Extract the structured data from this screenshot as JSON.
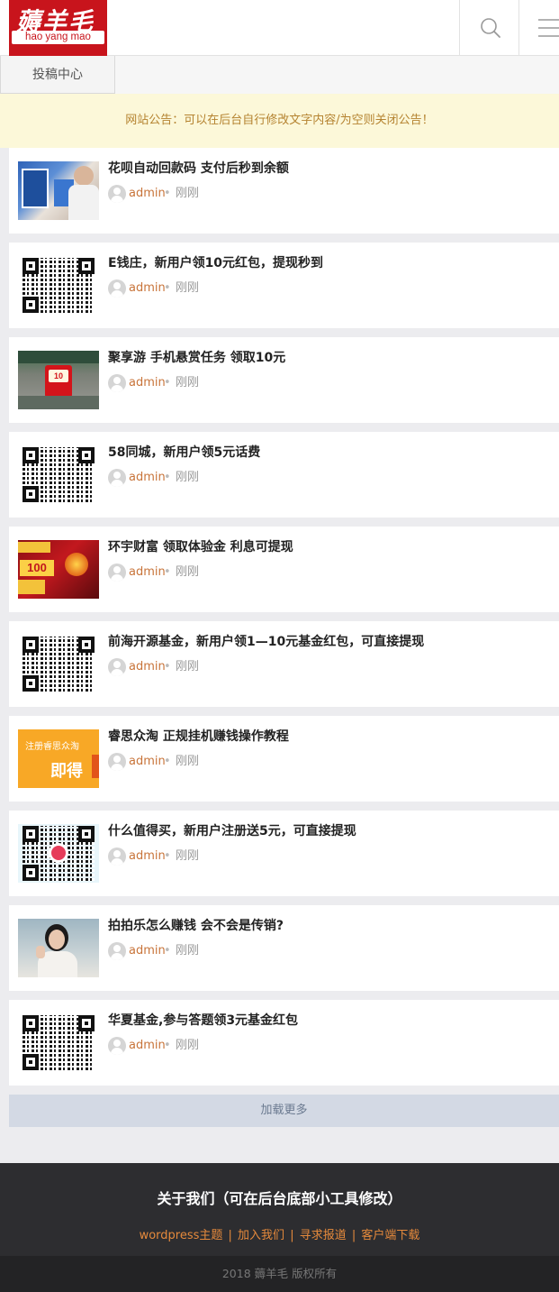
{
  "header": {
    "logo_cn": "薅羊毛",
    "logo_en": "hao yang mao"
  },
  "nav": {
    "tougao": "投稿中心"
  },
  "notice": "网站公告：可以在后台自行修改文字内容/为空则关闭公告！",
  "posts": [
    {
      "title": "花呗自动回款码 支付后秒到余额",
      "author": "admin",
      "time": "刚刚",
      "thumb": "photo-blue"
    },
    {
      "title": "E钱庄，新用户领10元红包，提现秒到",
      "author": "admin",
      "time": "刚刚",
      "thumb": "qr-code"
    },
    {
      "title": "聚享游 手机悬赏任务 领取10元",
      "author": "admin",
      "time": "刚刚",
      "thumb": "app-screen",
      "thumb_text": "10"
    },
    {
      "title": "58同城，新用户领5元话费",
      "author": "admin",
      "time": "刚刚",
      "thumb": "qr-code"
    },
    {
      "title": "环宇财富 领取体验金 利息可提现",
      "author": "admin",
      "time": "刚刚",
      "thumb": "banner-red",
      "thumb_text": "100"
    },
    {
      "title": "前海开源基金，新用户领1—10元基金红包，可直接提现",
      "author": "admin",
      "time": "刚刚",
      "thumb": "qr-code"
    },
    {
      "title": "睿思众淘 正规挂机赚钱操作教程",
      "author": "admin",
      "time": "刚刚",
      "thumb": "banner-orange",
      "thumb_text_1": "注册睿思众淘",
      "thumb_text_2": "即得"
    },
    {
      "title": "什么值得买，新用户注册送5元，可直接提现",
      "author": "admin",
      "time": "刚刚",
      "thumb": "qr-code-logo"
    },
    {
      "title": "拍拍乐怎么赚钱 会不会是传销?",
      "author": "admin",
      "time": "刚刚",
      "thumb": "photo-person"
    },
    {
      "title": "华夏基金,参与答题领3元基金红包",
      "author": "admin",
      "time": "刚刚",
      "thumb": "qr-code"
    }
  ],
  "meta_dot": "•",
  "load_more": "加载更多",
  "footer": {
    "title": "关于我们（可在后台底部小工具修改）",
    "links": [
      "wordpress主题",
      "加入我们",
      "寻求报道",
      "客户端下载"
    ],
    "separator": "|",
    "copyright": "2018 薅羊毛 版权所有"
  },
  "colors": {
    "brand_red": "#c8141c",
    "notice_bg": "#fcf8d9",
    "notice_text": "#b58330",
    "author": "#c8743a",
    "footer_bg": "#2d2d30",
    "footer_link": "#e68a3c"
  },
  "icons": {
    "search": "search-icon",
    "menu": "menu-icon",
    "avatar": "user-avatar-icon"
  }
}
